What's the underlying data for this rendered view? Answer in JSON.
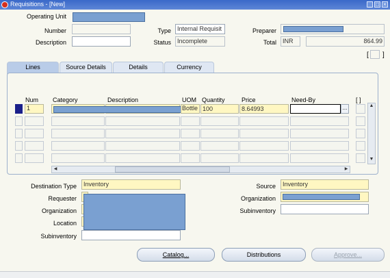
{
  "window": {
    "title": "Requisitions - [New]"
  },
  "header": {
    "operating_unit_label": "Operating Unit",
    "number_label": "Number",
    "description_label": "Description",
    "type_label": "Type",
    "type_value": "Internal Requisit",
    "status_label": "Status",
    "status_value": "Incomplete",
    "preparer_label": "Preparer",
    "total_label": "Total",
    "currency_value": "INR",
    "total_value": "864.99",
    "bracket_open": "[",
    "bracket_close": "]"
  },
  "tabs": [
    {
      "label": "Lines"
    },
    {
      "label": "Source Details"
    },
    {
      "label": "Details"
    },
    {
      "label": "Currency"
    }
  ],
  "lines": {
    "columns": [
      "Num",
      "Category",
      "Description",
      "UOM",
      "Quantity",
      "Price",
      "Need-By"
    ],
    "row1": {
      "num": "1",
      "uom": "Bottle",
      "quantity": "100",
      "price": "8.64993"
    },
    "bracket_col": "[ ]",
    "lov_button": "...",
    "scroll_up": "▲",
    "scroll_down": "▼",
    "hscroll_left": "◀",
    "hscroll_right": "▶"
  },
  "destination": {
    "destination_type_label": "Destination Type",
    "destination_type_value": "Inventory",
    "requester_label": "Requester",
    "organization_label": "Organization",
    "location_label": "Location",
    "subinventory_label": "Subinventory",
    "source_label": "Source",
    "source_value": "Inventory",
    "source_organization_label": "Organization",
    "source_subinventory_label": "Subinventory"
  },
  "buttons": {
    "catalog": "Catalog...",
    "distributions": "Distributions",
    "approve": "Approve..."
  },
  "colors": {
    "title_bar": "#3a69c9",
    "required_field": "#fff7c2",
    "tab_active": "#b9cce8"
  }
}
